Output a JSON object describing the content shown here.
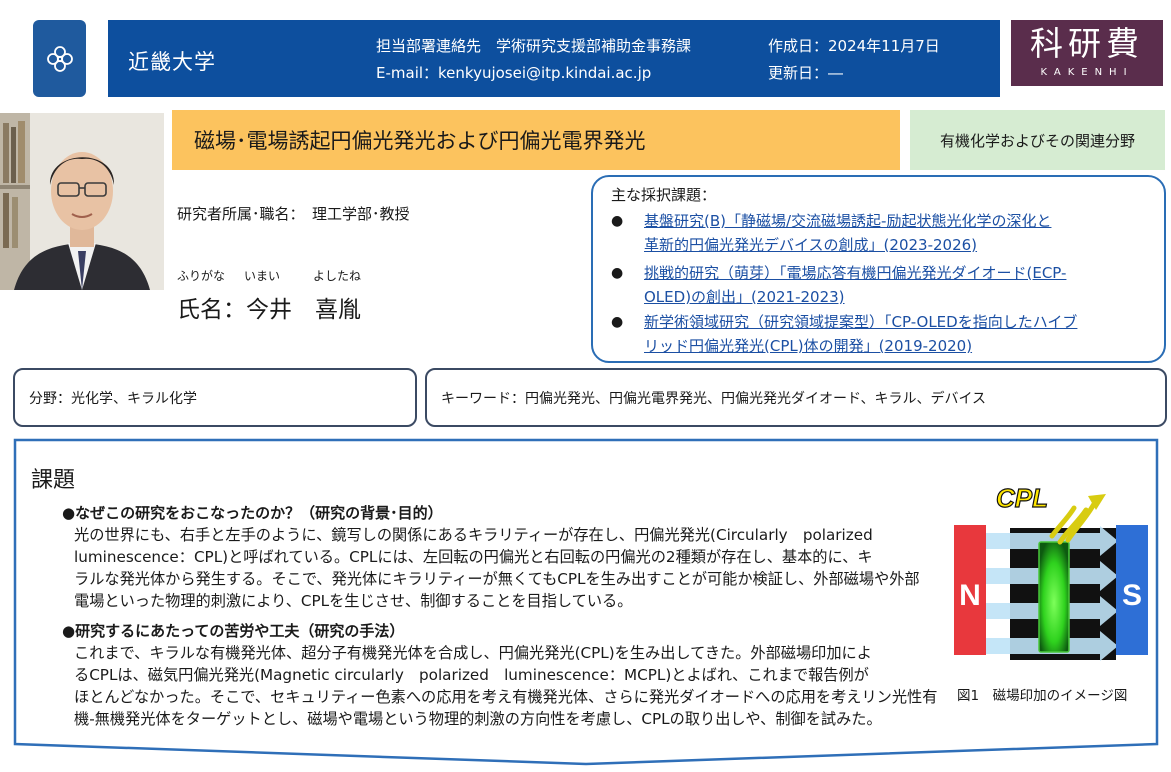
{
  "header": {
    "university": "近畿大学",
    "contact": "担当部署連絡先　学術研究支援部補助金事務課",
    "email": "E-mail：kenkyujosei@itp.kindai.ac.jp",
    "created": "作成日：2024年11月7日",
    "updated": "更新日：―"
  },
  "kakenhi": {
    "big": "科研費",
    "small": "KAKENHI"
  },
  "title": "磁場･電場誘起円偏光発光および円偏光電界発光",
  "field_label": "有機化学およびその関連分野",
  "researcher": {
    "affiliation": "研究者所属･職名：　理工学部･教授",
    "furigana": [
      "ふりがな",
      "いまい",
      "よしたね"
    ],
    "name": "氏名：今井　喜胤"
  },
  "grants": {
    "label": "主な採択課題：",
    "items": [
      "基盤研究(B)「静磁場/交流磁場誘起-励起状態光化学の深化と革新的円偏光発光デバイスの創成」(2023-2026)",
      "挑戦的研究（萌芽）「電場応答有機円偏光発光ダイオード(ECP-OLED)の創出」(2021-2023)",
      "新学術領域研究（研究領域提案型）「CP-OLEDを指向したハイブリッド円偏光発光(CPL)体の開発」(2019-2020)"
    ],
    "lines": [
      [
        "基盤研究(B)「静磁場/交流磁場誘起-励起状態光化学の深化と",
        "革新的円偏光発光デバイスの創成」(2023-2026)"
      ],
      [
        "挑戦的研究（萌芽）「電場応答有機円偏光発光ダイオード(ECP-",
        "OLED)の創出」(2021-2023)"
      ],
      [
        "新学術領域研究（研究領域提案型）「CP-OLEDを指向したハイブ",
        "リッド円偏光発光(CPL)体の開発」(2019-2020)"
      ]
    ]
  },
  "field_area": "分野：光化学、キラル化学",
  "keywords": "キーワード：円偏光発光、円偏光電界発光、円偏光発光ダイオード、キラル、デバイス",
  "main": {
    "title": "課題",
    "section1_heading": "●なぜこの研究をおこなったのか？（研究の背景･目的）",
    "section1_lines": [
      "光の世界にも、右手と左手のように、鏡写しの関係にあるキラリティーが存在し、円偏光発光(Circularly　polarized",
      "luminescence：CPL)と呼ばれている。CPLには、左回転の円偏光と右回転の円偏光の2種類が存在し、基本的に、キ",
      "ラルな発光体から発生する。そこで、発光体にキラリティーが無くてもCPLを生み出すことが可能か検証し、外部磁場や外部",
      "電場といった物理的刺激により、CPLを生じさせ、制御することを目指している。"
    ],
    "section2_heading": "●研究するにあたっての苦労や工夫（研究の手法）",
    "section2_lines": [
      "これまで、キラルな有機発光体、超分子有機発光体を合成し、円偏光発光(CPL)を生み出してきた。外部磁場印加によ",
      "るCPLは、磁気円偏光発光(Magnetic circularly　polarized　luminescence：MCPL)とよばれ、これまで報告例が",
      "ほとんどなかった。そこで、セキュリティー色素への応用を考え有機発光体、さらに発光ダイオードへの応用を考えリン光性有",
      "機-無機発光体をターゲットとし、磁場や電場という物理的刺激の方向性を考慮し、CPLの取り出しや、制御を試みた。"
    ]
  },
  "figure": {
    "cpl_label": "CPL",
    "north": "N",
    "south": "S",
    "caption": "図1　磁場印加のイメージ図"
  },
  "colors": {
    "header_blue": "#0d4f9e",
    "title_orange": "#fcc35e",
    "field_green": "#d6ecd2",
    "kakenhi_purple": "#5a2d4c",
    "magnet_red": "#e8383d",
    "magnet_blue": "#2e6fd6",
    "glow_green": "#39e62a"
  },
  "icons": {
    "logo": "flower-icon"
  }
}
